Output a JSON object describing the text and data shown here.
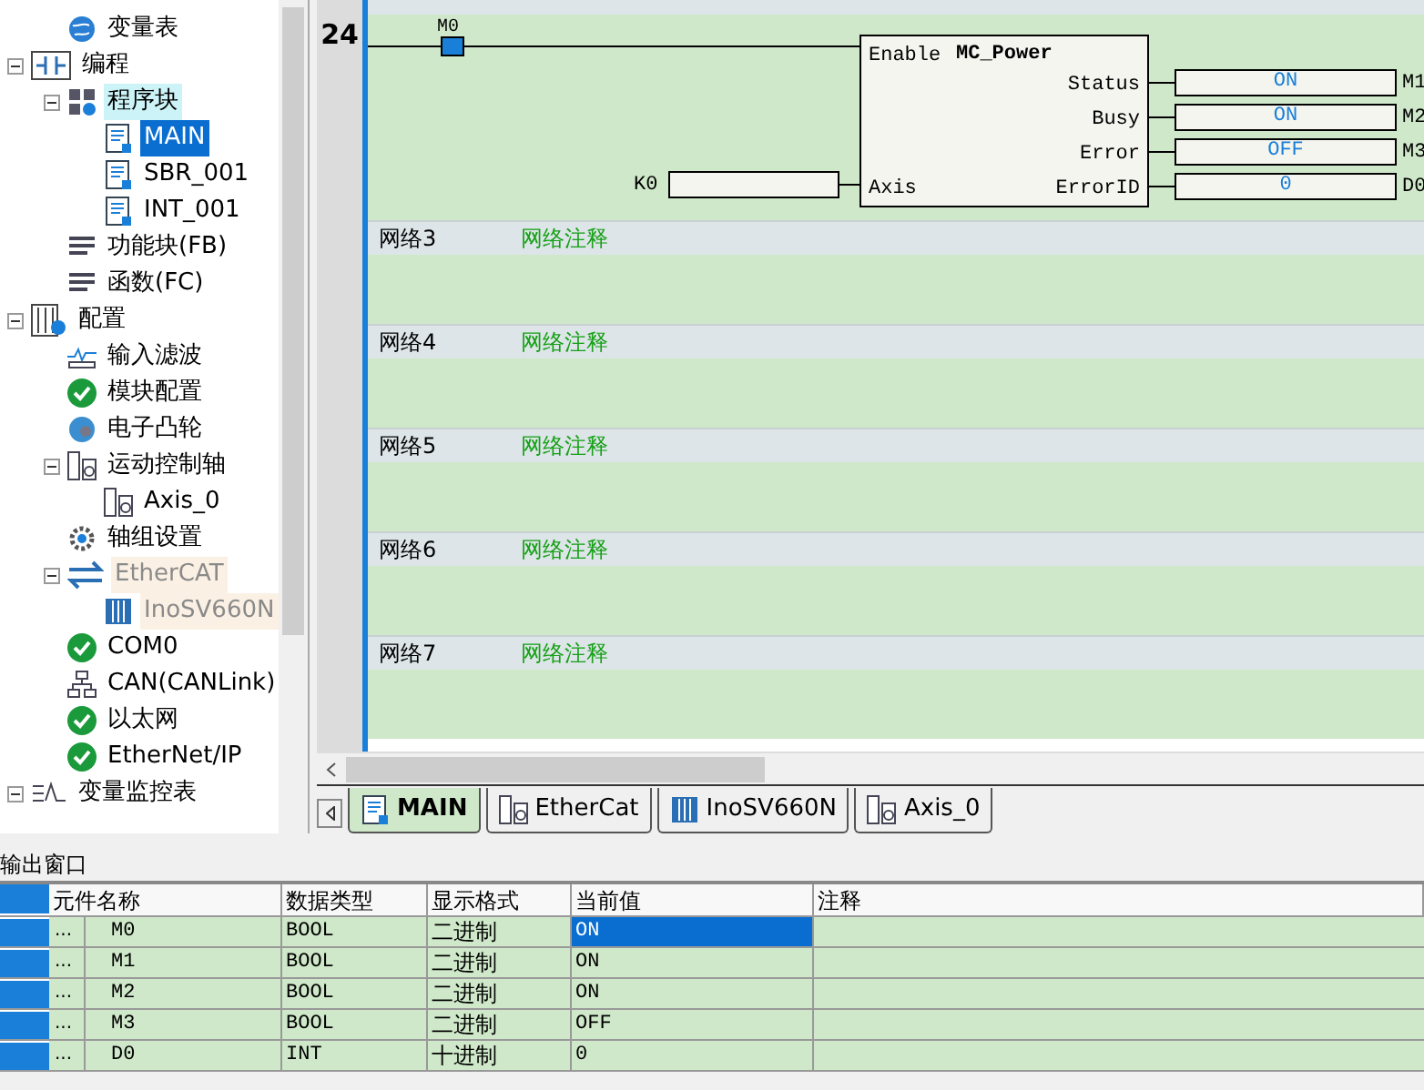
{
  "tree_top": [
    {
      "label": "变量表",
      "kind": "globe"
    }
  ],
  "tree": [
    {
      "label": "编程",
      "kind": "ladder",
      "expanded": true,
      "children": [
        {
          "label": "程序块",
          "kind": "blocks",
          "expanded": true,
          "highlighted": true,
          "children": [
            {
              "label": "MAIN",
              "kind": "document",
              "selected": true
            },
            {
              "label": "SBR_001",
              "kind": "document",
              "selected": false
            },
            {
              "label": "INT_001",
              "kind": "document",
              "selected": false
            }
          ]
        },
        {
          "label": "功能块(FB)",
          "kind": "list"
        },
        {
          "label": "函数(FC)",
          "kind": "list"
        }
      ]
    },
    {
      "label": "配置",
      "kind": "config",
      "expanded": true,
      "children": [
        {
          "label": "输入滤波",
          "kind": "wave"
        },
        {
          "label": "模块配置",
          "kind": "check"
        },
        {
          "label": "电子凸轮",
          "kind": "cam"
        },
        {
          "label": "运动控制轴",
          "kind": "axis",
          "expanded": true,
          "children": [
            {
              "label": "Axis_0",
              "kind": "axis"
            }
          ]
        },
        {
          "label": "轴组设置",
          "kind": "gear"
        },
        {
          "label": "EtherCAT",
          "kind": "arrows",
          "disabled": true,
          "expanded": true,
          "children": [
            {
              "label": "InoSV660N",
              "kind": "drive",
              "disabled": true
            }
          ]
        },
        {
          "label": "COM0",
          "kind": "check"
        },
        {
          "label": "CAN(CANLink)",
          "kind": "network"
        },
        {
          "label": "以太网",
          "kind": "check"
        },
        {
          "label": "EtherNet/IP",
          "kind": "check"
        }
      ]
    },
    {
      "label": "变量监控表",
      "kind": "monitor",
      "expanded": true
    }
  ],
  "editor": {
    "line_number": "24",
    "contact": {
      "label": "M0",
      "on": true
    },
    "block": {
      "name": "MC_Power",
      "enable": "Enable",
      "input_pin": "Axis",
      "input_var": "K0",
      "outputs": [
        {
          "pin": "Status",
          "value": "ON",
          "var": "M1"
        },
        {
          "pin": "Busy",
          "value": "ON",
          "var": "M2"
        },
        {
          "pin": "Error",
          "value": "OFF",
          "var": "M3"
        },
        {
          "pin": "ErrorID",
          "value": "0",
          "var": "D0"
        }
      ]
    },
    "networks": [
      {
        "title": "网络3",
        "comment": "网络注释"
      },
      {
        "title": "网络4",
        "comment": "网络注释"
      },
      {
        "title": "网络5",
        "comment": "网络注释"
      },
      {
        "title": "网络6",
        "comment": "网络注释"
      },
      {
        "title": "网络7",
        "comment": "网络注释"
      }
    ]
  },
  "tabs": [
    {
      "label": "MAIN",
      "kind": "document",
      "selected": true
    },
    {
      "label": "EtherCat",
      "kind": "axis",
      "selected": false
    },
    {
      "label": "InoSV660N",
      "kind": "drive",
      "selected": false
    },
    {
      "label": "Axis_0",
      "kind": "axis",
      "selected": false
    }
  ],
  "output_window": {
    "title": "输出窗口",
    "columns": [
      "元件名称",
      "数据类型",
      "显示格式",
      "当前值",
      "注释"
    ],
    "rows": [
      {
        "more": "...",
        "name": "M0",
        "type": "BOOL",
        "format": "二进制",
        "value": "ON",
        "selected": true
      },
      {
        "more": "...",
        "name": "M1",
        "type": "BOOL",
        "format": "二进制",
        "value": "ON",
        "selected": false
      },
      {
        "more": "...",
        "name": "M2",
        "type": "BOOL",
        "format": "二进制",
        "value": "ON",
        "selected": false
      },
      {
        "more": "...",
        "name": "M3",
        "type": "BOOL",
        "format": "二进制",
        "value": "OFF",
        "selected": false
      },
      {
        "more": "...",
        "name": "D0",
        "type": "INT",
        "format": "十进制",
        "value": "0",
        "selected": false
      }
    ]
  }
}
